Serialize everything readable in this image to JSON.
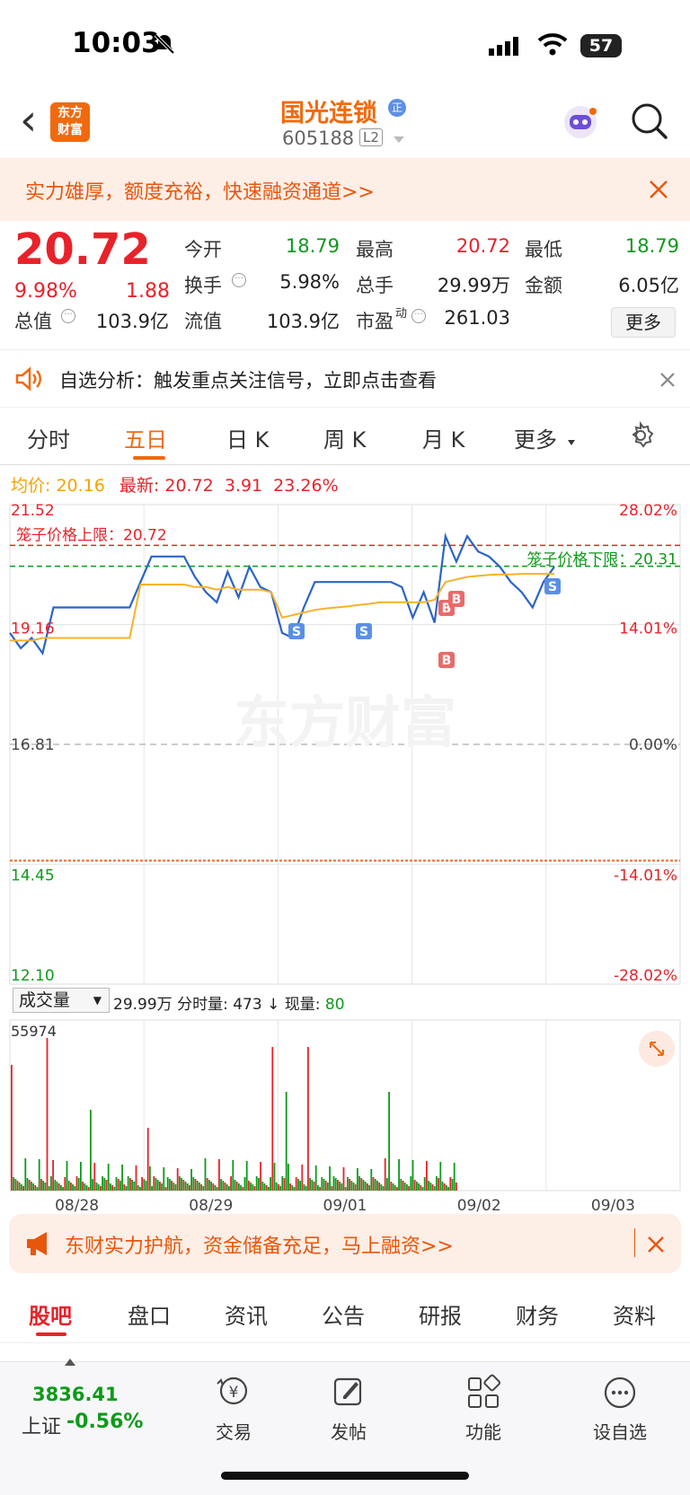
{
  "status_bar": {
    "time": "10:03",
    "battery": "57"
  },
  "header": {
    "back": "‹",
    "logo_text": "东方\n财富",
    "title": "国光连锁",
    "badge": "正",
    "code": "605188",
    "level": "L2"
  },
  "banner_top": {
    "text": "实力雄厚，额度充裕，快速融资通道>>"
  },
  "quote": {
    "price": "20.72",
    "change_pct": "9.98%",
    "change": "1.88",
    "open_label": "今开",
    "open": "18.79",
    "high_label": "最高",
    "high": "20.72",
    "low_label": "最低",
    "low": "18.79",
    "turnover_label": "换手",
    "turnover": "5.98%",
    "volume_label": "总手",
    "volume": "29.99万",
    "amount_label": "金额",
    "amount": "6.05亿",
    "mcap_label": "总值",
    "mcap": "103.9亿",
    "float_label": "流值",
    "float": "103.9亿",
    "pe_label": "市盈",
    "pe_sup": "动",
    "pe": "261.03",
    "more": "更多"
  },
  "notice": {
    "text": "自选分析：触发重点关注信号，立即点击查看"
  },
  "tabs": [
    "分时",
    "五日",
    "日 K",
    "周 K",
    "月 K",
    "更多"
  ],
  "active_tab": 1,
  "chart_info": {
    "avg_label": "均价:",
    "avg": "20.16",
    "latest_label": "最新:",
    "latest": "20.72",
    "change": "3.91",
    "change_pct": "23.26%"
  },
  "chart_data": {
    "type": "line",
    "y_left_ticks": [
      "21.52",
      "19.16",
      "16.81",
      "14.45",
      "12.10"
    ],
    "y_right_ticks": [
      "28.02%",
      "14.01%",
      "0.00%",
      "-14.01%",
      "-28.02%"
    ],
    "ylim": [
      12.1,
      21.52
    ],
    "prev_close": 16.81,
    "upper_limit_label": "笼子价格上限：20.72",
    "lower_limit_label": "笼子价格下限：20.31",
    "upper_limit": 20.72,
    "lower_limit": 20.31,
    "watermark": "东方财富",
    "x_labels": [
      "08/28",
      "08/29",
      "09/01",
      "09/02",
      "09/03"
    ],
    "series": [
      {
        "values": [
          19.0,
          18.7,
          18.9,
          18.6,
          19.5,
          19.5,
          19.5,
          19.5,
          19.5,
          19.5,
          19.5,
          19.5,
          20.0,
          20.5,
          20.5,
          20.5,
          20.5,
          20.1,
          19.8,
          19.6,
          20.2,
          19.7,
          20.3,
          19.9,
          19.8,
          19.0,
          18.9,
          19.5,
          20.0,
          20.0,
          20.0,
          20.0,
          20.0,
          20.0,
          20.0,
          20.0,
          19.9,
          19.3,
          19.8,
          19.2,
          20.9,
          20.4,
          20.9,
          20.6,
          20.5,
          20.3,
          20.0,
          19.8,
          19.5,
          20.0,
          20.3
        ]
      },
      {
        "values": [
          18.85,
          18.85,
          18.85,
          18.9,
          18.9,
          18.9,
          18.9,
          18.9,
          18.9,
          18.9,
          18.9,
          18.9,
          19.95,
          19.95,
          19.95,
          19.95,
          19.95,
          19.9,
          19.9,
          19.85,
          19.9,
          19.85,
          19.85,
          19.85,
          19.8,
          19.3,
          19.35,
          19.4,
          19.45,
          19.48,
          19.5,
          19.52,
          19.55,
          19.57,
          19.6,
          19.6,
          19.6,
          19.6,
          19.6,
          19.65,
          20.0,
          20.05,
          20.1,
          20.12,
          20.14,
          20.15,
          20.15,
          20.16,
          20.16,
          20.16,
          20.16
        ]
      }
    ],
    "markers": [
      "S",
      "S",
      "S",
      "B",
      "B",
      "B",
      "S"
    ]
  },
  "volume": {
    "selector": "成交量",
    "total": "29.99万",
    "minute_label": "分时量:",
    "minute": "473 ↓",
    "now_label": "现量:",
    "now": "80",
    "max": "55974"
  },
  "banner_bottom": {
    "text": "东财实力护航，资金储备充足，马上融资>>"
  },
  "bottom_tabs": [
    "股吧",
    "盘口",
    "资讯",
    "公告",
    "研报",
    "财务",
    "资料"
  ],
  "bottom_nav": {
    "index_value": "3836.41",
    "index_name": "上证",
    "index_change": "-0.56%",
    "items": [
      "交易",
      "发帖",
      "功能",
      "设自选"
    ]
  },
  "colors": {
    "accent": "#f06a0d",
    "up": "#e8222a",
    "down": "#0d9a1a",
    "price_line": "#2b64c6",
    "avg_line": "#f6b12a"
  }
}
